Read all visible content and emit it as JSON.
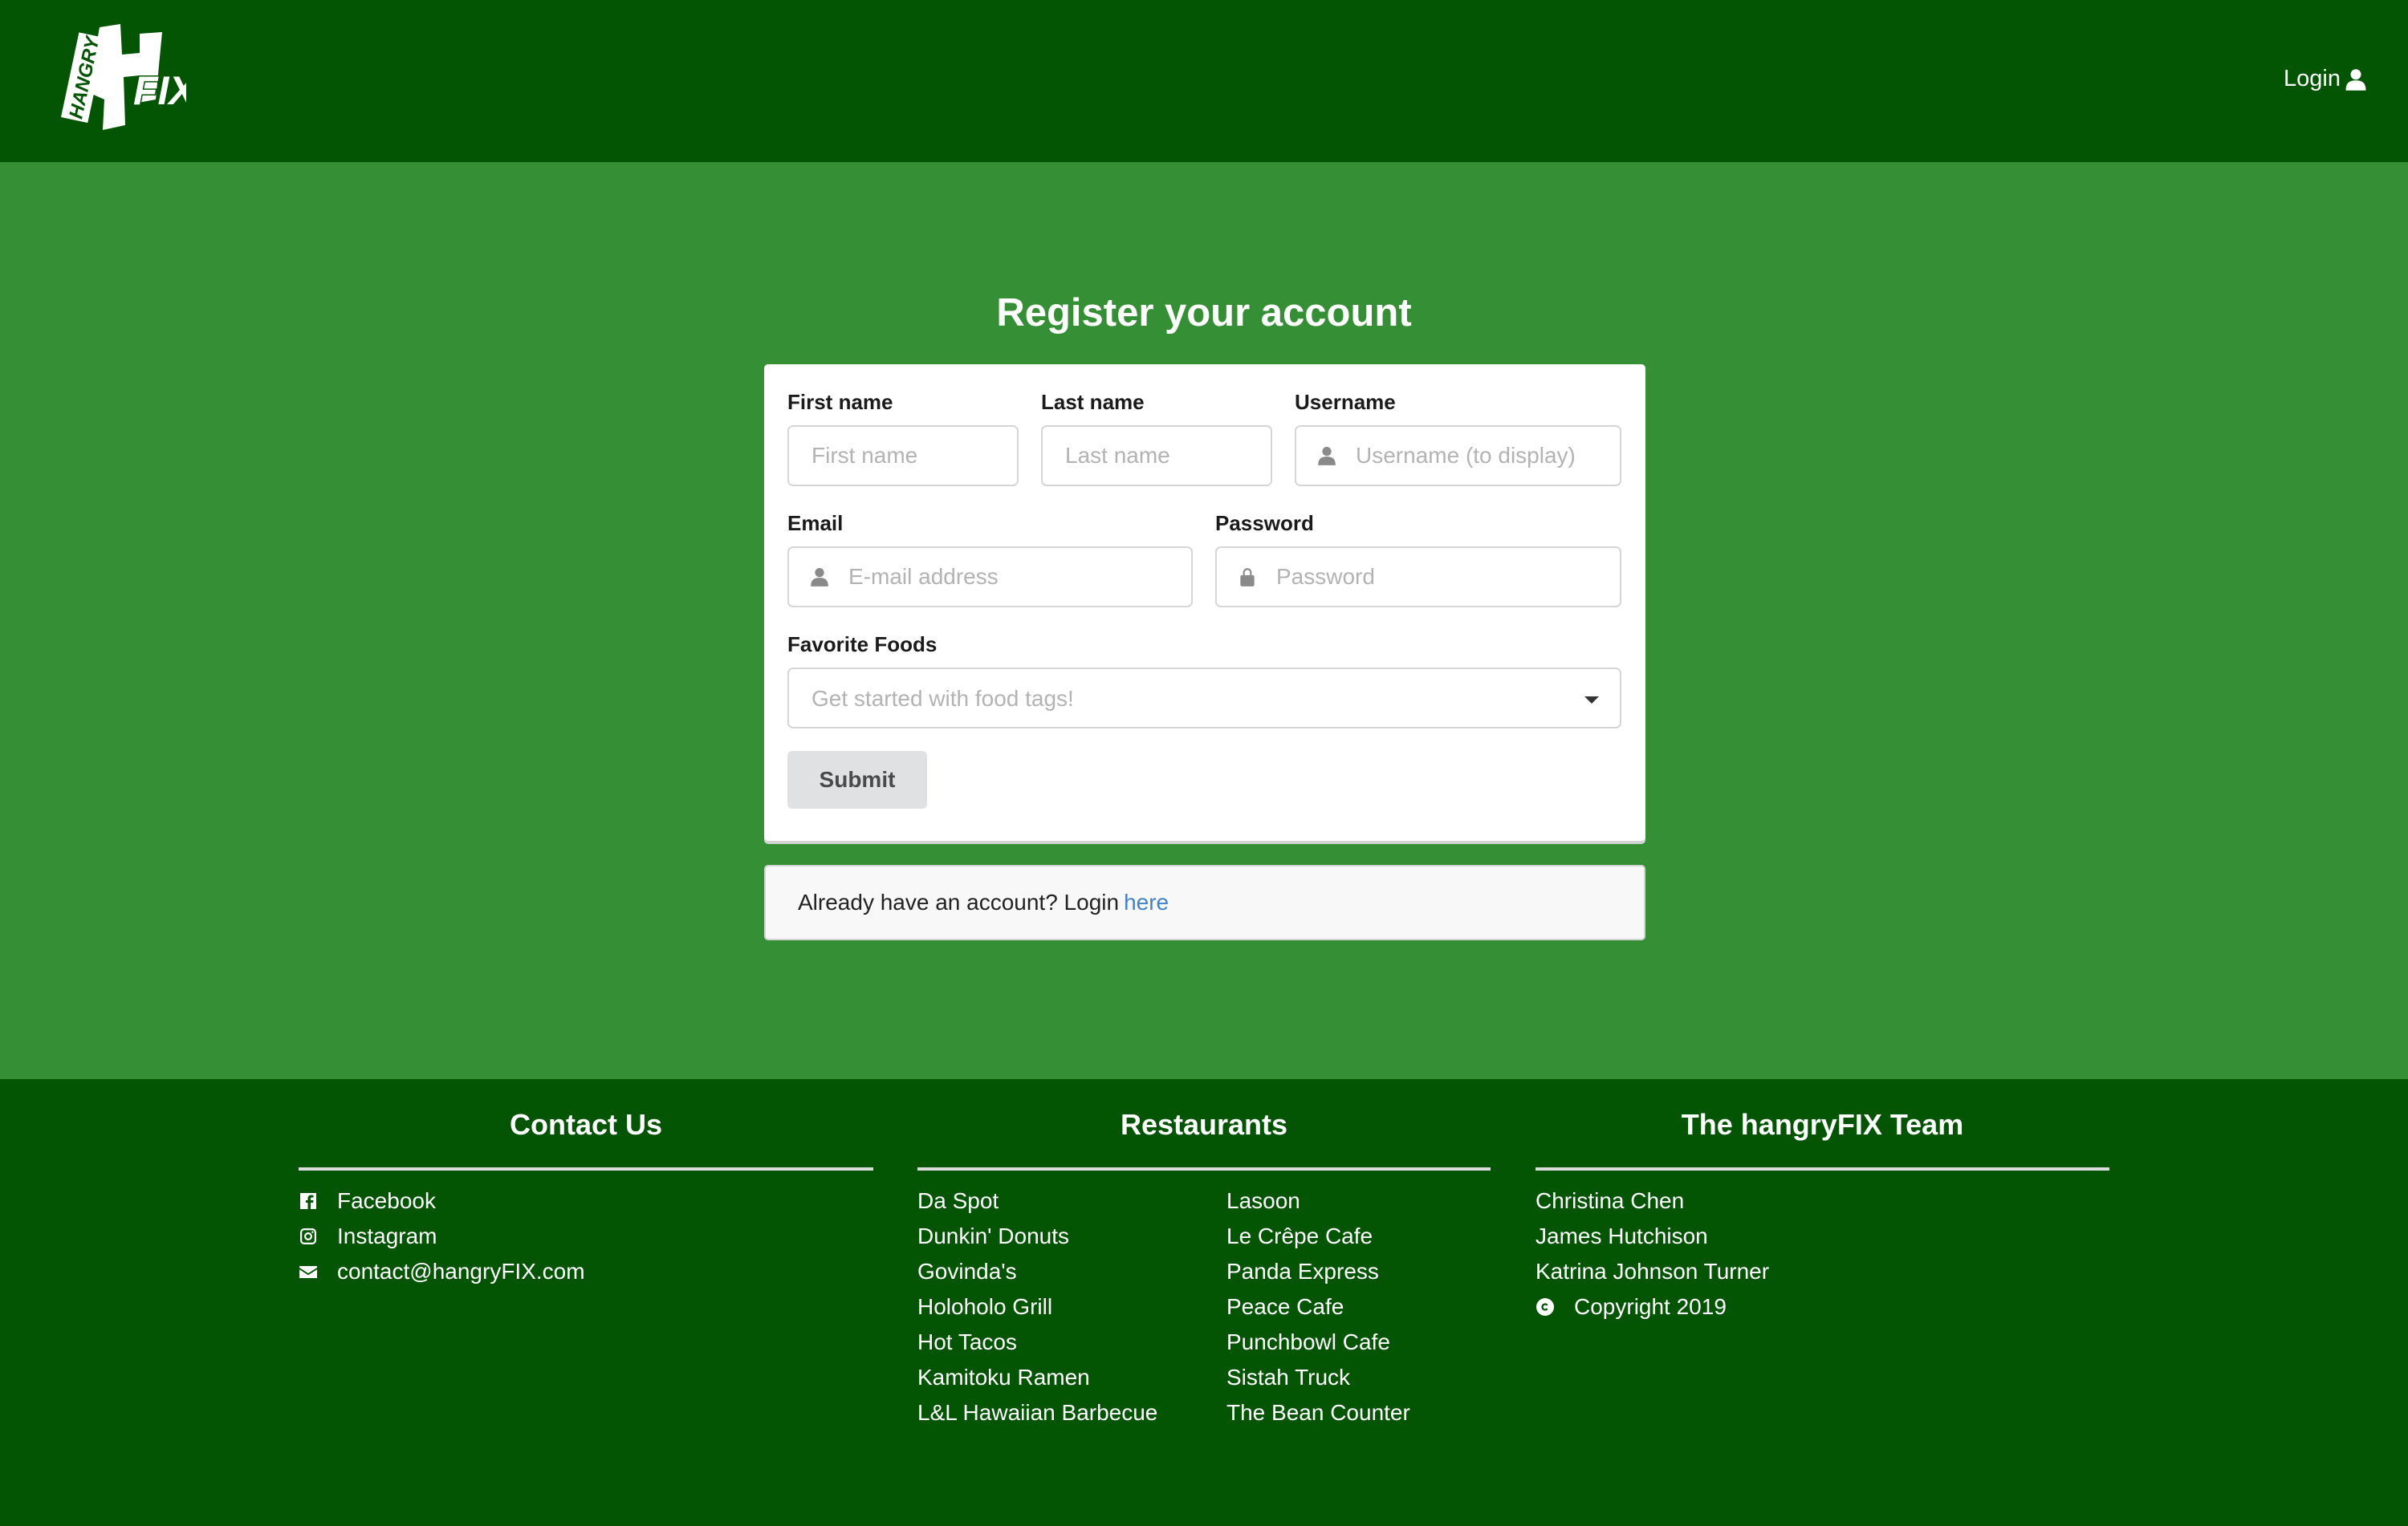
{
  "header": {
    "logo_text_small": "HANGRY",
    "logo_text_big": "FIX",
    "login_label": "Login"
  },
  "main": {
    "title": "Register your account",
    "form": {
      "first_name": {
        "label": "First name",
        "placeholder": "First name"
      },
      "last_name": {
        "label": "Last name",
        "placeholder": "Last name"
      },
      "username": {
        "label": "Username",
        "placeholder": "Username (to display)"
      },
      "email": {
        "label": "Email",
        "placeholder": "E-mail address"
      },
      "password": {
        "label": "Password",
        "placeholder": "Password"
      },
      "favorite_foods": {
        "label": "Favorite Foods",
        "placeholder": "Get started with food tags!"
      },
      "submit_label": "Submit"
    },
    "login_prompt": {
      "text": "Already have an account? Login",
      "link_text": "here"
    }
  },
  "footer": {
    "contact": {
      "heading": "Contact Us",
      "items": [
        "Facebook",
        "Instagram",
        "contact@hangryFIX.com"
      ]
    },
    "restaurants": {
      "heading": "Restaurants",
      "col1": [
        "Da Spot",
        "Dunkin' Donuts",
        "Govinda's",
        "Holoholo Grill",
        "Hot Tacos",
        "Kamitoku Ramen",
        "L&L Hawaiian Barbecue"
      ],
      "col2": [
        "Lasoon",
        "Le Crêpe Cafe",
        "Panda Express",
        "Peace Cafe",
        "Punchbowl Cafe",
        "Sistah Truck",
        "The Bean Counter"
      ]
    },
    "team": {
      "heading": "The hangryFIX Team",
      "members": [
        "Christina Chen",
        "James Hutchison",
        "Katrina Johnson Turner"
      ],
      "copyright": "Copyright 2019"
    }
  },
  "colors": {
    "header_bg": "#035403",
    "page_bg": "#358f35",
    "link": "#4183c4",
    "button_bg": "#e0e1e2"
  },
  "icons": [
    "user-icon",
    "lock-icon",
    "facebook-icon",
    "instagram-icon",
    "envelope-icon",
    "copyright-icon",
    "caret-down-icon"
  ]
}
